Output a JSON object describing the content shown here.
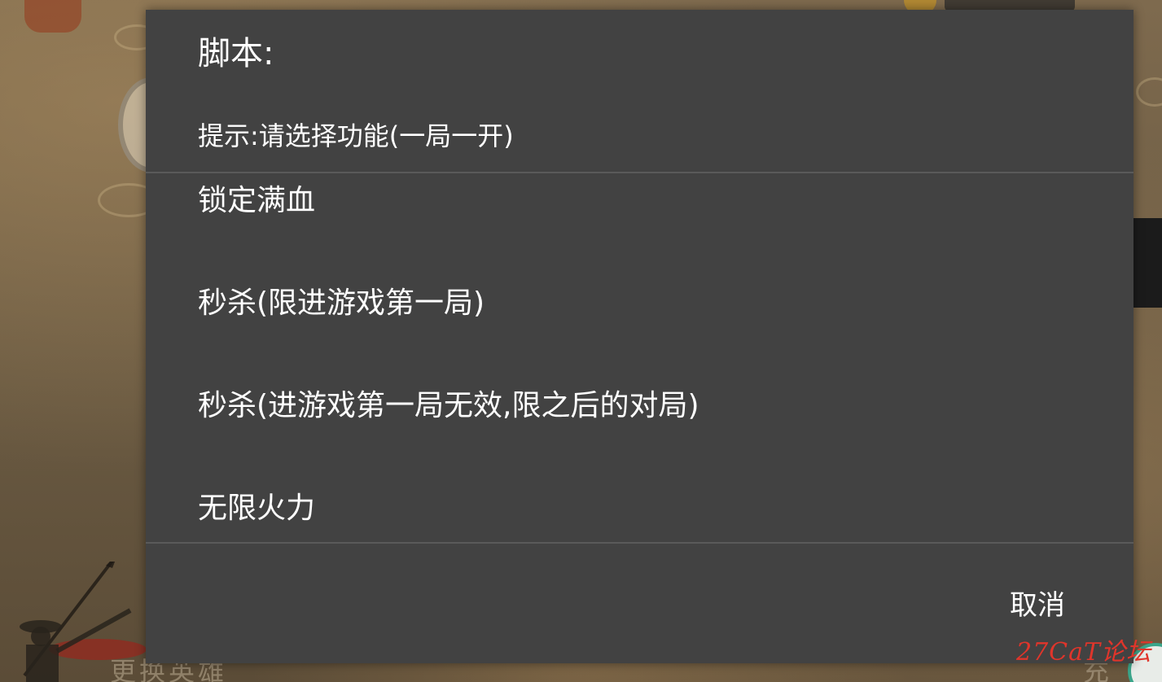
{
  "dialog": {
    "title": "脚本:",
    "hint": "提示:请选择功能(一局一开)",
    "options": [
      {
        "label": "锁定满血"
      },
      {
        "label": "秒杀(限进游戏第一局)"
      },
      {
        "label": "秒杀(进游戏第一局无效,限之后的对局)"
      },
      {
        "label": "无限火力"
      }
    ],
    "cancel_label": "取消"
  },
  "background": {
    "bottom_left_text": "更换英雄",
    "bottom_right_text": "充"
  },
  "watermark": "27CaT论坛",
  "colors": {
    "dialog_bg": "#424242",
    "divider": "#5a5a5a",
    "text": "#ffffff",
    "watermark": "#e0352b"
  }
}
